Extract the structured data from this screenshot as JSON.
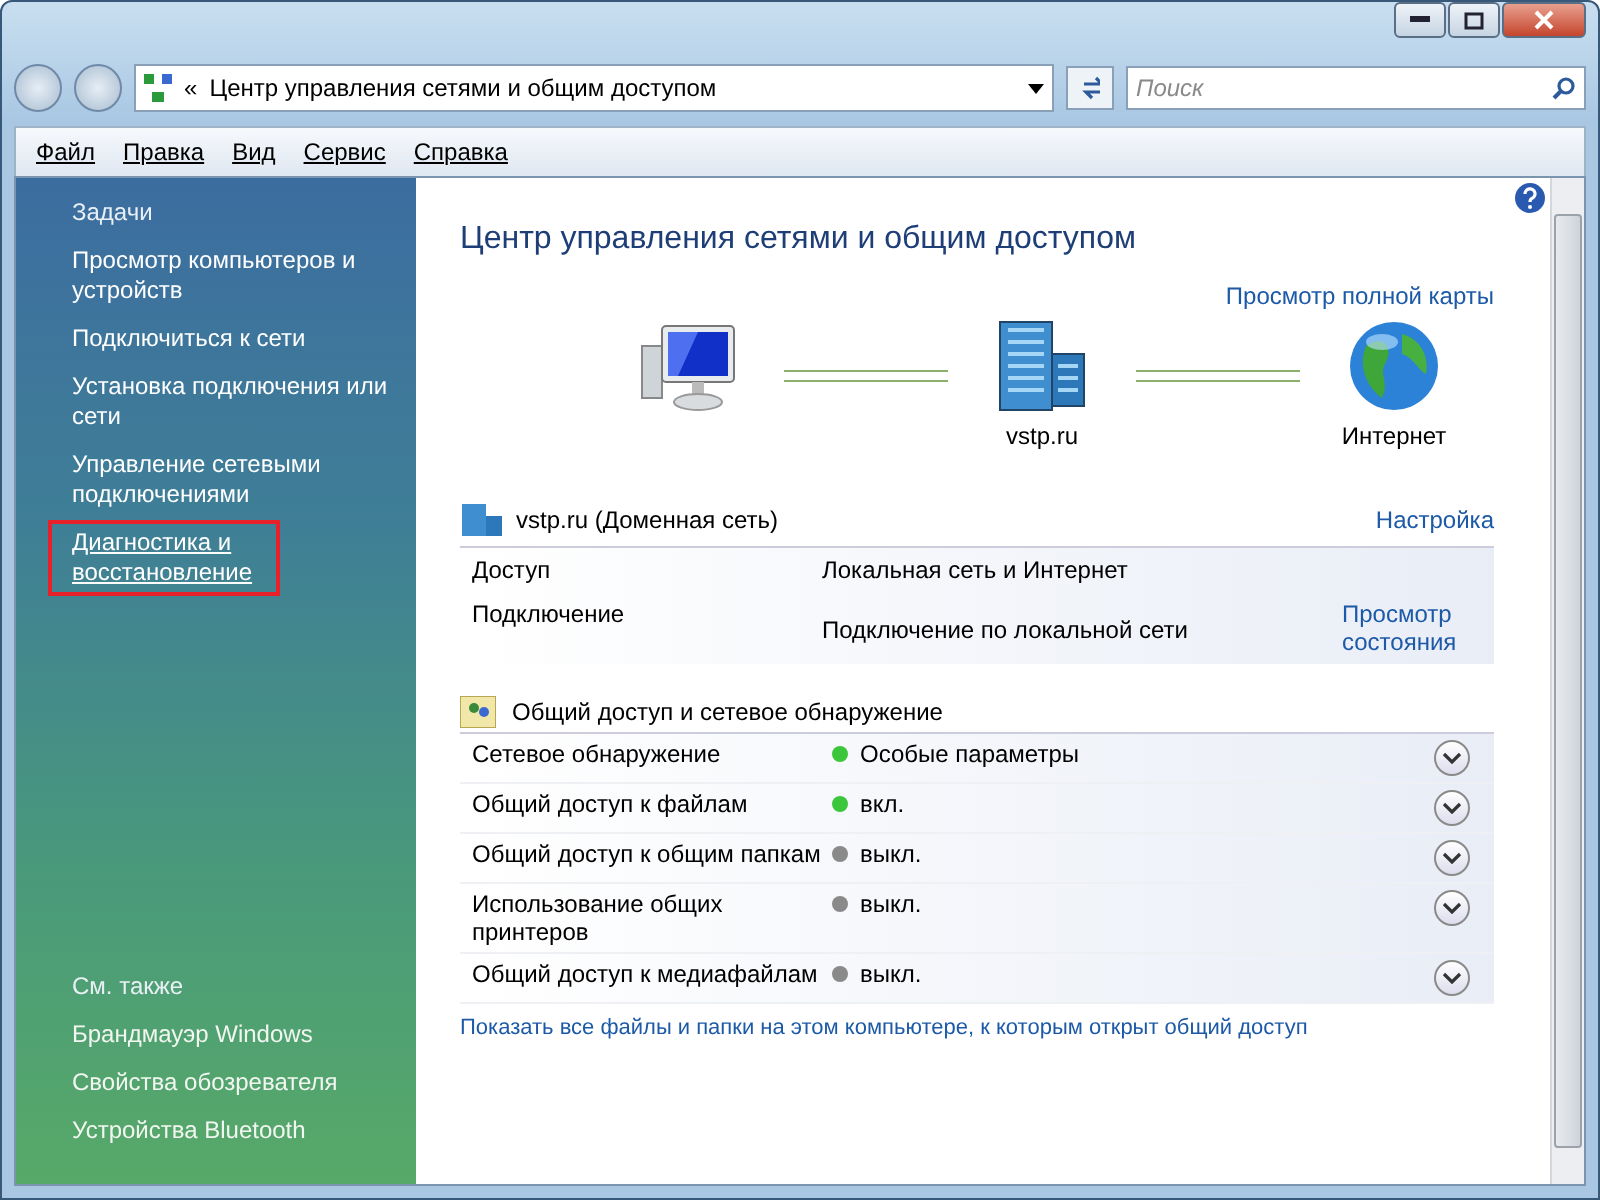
{
  "address_bar": {
    "path": "Центр управления сетями и общим доступом",
    "overflow_glyph": "«"
  },
  "search": {
    "placeholder": "Поиск"
  },
  "menu": [
    "Файл",
    "Правка",
    "Вид",
    "Сервис",
    "Справка"
  ],
  "sidebar": {
    "tasks_title": "Задачи",
    "tasks": [
      {
        "label": "Просмотр компьютеров и устройств",
        "highlighted": false
      },
      {
        "label": "Подключиться к сети",
        "highlighted": false
      },
      {
        "label": "Установка подключения или сети",
        "highlighted": false
      },
      {
        "label": "Управление сетевыми подключениями",
        "highlighted": false
      },
      {
        "label": "Диагностика и восстановление",
        "highlighted": true
      }
    ],
    "see_also_title": "См. также",
    "see_also": [
      "Брандмауэр Windows",
      "Свойства обозревателя",
      "Устройства Bluetooth"
    ]
  },
  "main": {
    "title": "Центр управления сетями и общим доступом",
    "full_map_link": "Просмотр полной карты",
    "map": [
      {
        "kind": "computer"
      },
      {
        "kind": "network",
        "label": "vstp.ru"
      },
      {
        "kind": "internet",
        "label": "Интернет"
      }
    ],
    "network": {
      "name": "vstp.ru (Доменная сеть)",
      "settings_link": "Настройка",
      "rows": [
        {
          "label": "Доступ",
          "value": "Локальная сеть и Интернет"
        },
        {
          "label": "Подключение",
          "value": "Подключение по локальной сети",
          "link": "Просмотр состояния"
        }
      ]
    },
    "sharing": {
      "title": "Общий доступ и сетевое обнаружение",
      "rows": [
        {
          "label": "Сетевое обнаружение",
          "on": true,
          "value": "Особые параметры"
        },
        {
          "label": "Общий доступ к файлам",
          "on": true,
          "value": "вкл."
        },
        {
          "label": "Общий доступ к общим папкам",
          "on": false,
          "value": "выкл."
        },
        {
          "label": "Использование общих принтеров",
          "on": false,
          "value": "выкл."
        },
        {
          "label": "Общий доступ к медиафайлам",
          "on": false,
          "value": "выкл."
        }
      ]
    },
    "bottom_link": "Показать все файлы и папки на этом компьютере, к которым открыт общий доступ"
  }
}
